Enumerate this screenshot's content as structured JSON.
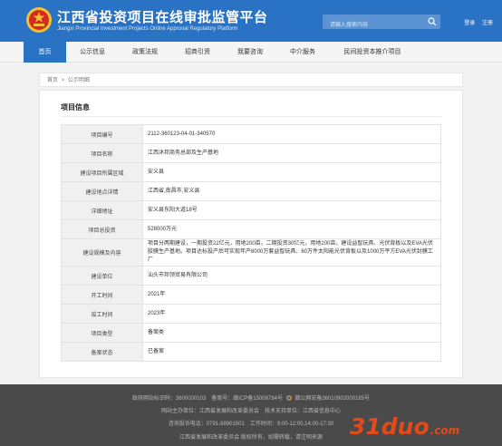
{
  "header": {
    "title": "江西省投资项目在线审批监管平台",
    "subtitle": "Jiangxi Provincial Investment Projects Online Approval Regulatory Platform",
    "search_placeholder": "请输入搜索内容",
    "login_label": "登录",
    "register_label": "注册",
    "colors": {
      "primary": "#2a72c4",
      "emblem_red": "#d22b1f",
      "emblem_gold": "#f3c234"
    },
    "icons": {
      "emblem": "national-emblem-icon",
      "search": "search-icon"
    }
  },
  "nav": {
    "items": [
      {
        "label": "首页",
        "active": true
      },
      {
        "label": "公示信息",
        "active": false
      },
      {
        "label": "政策法规",
        "active": false
      },
      {
        "label": "招商引资",
        "active": false
      },
      {
        "label": "我要咨询",
        "active": false
      },
      {
        "label": "中介服务",
        "active": false
      },
      {
        "label": "民间投资本推介项目",
        "active": false
      }
    ]
  },
  "breadcrumb": {
    "home": "首页",
    "separator": ">",
    "current": "公示明细"
  },
  "panel": {
    "title": "项目信息",
    "rows": [
      {
        "key": "项目编号",
        "value": "2112-360123-04-01-340570"
      },
      {
        "key": "项目名称",
        "value": "江西沐邦商务总部及生产基地"
      },
      {
        "key": "建设项目所属区域",
        "value": "安义县"
      },
      {
        "key": "建设地点详情",
        "value": "江西省,南昌市,安义县"
      },
      {
        "key": "详细地址",
        "value": "安义县东阳大道18号"
      },
      {
        "key": "项目总投资",
        "value": "528000万元"
      },
      {
        "key": "建设规模及内容",
        "value": "项目分两期建设，一期投资22亿元，用地200亩，二期投资30亿元，用地200亩，建设益智玩具、光伏背板以及EVA光伏胶膜生产基地。项目达标投产后可实现年产8000万套益智玩具、60万件太阳能光伏背板以及1000万平方EVA光伏封膜工厂"
      },
      {
        "key": "建设单位",
        "value": "汕头市邦领贸易有限公司"
      },
      {
        "key": "开工时间",
        "value": "2021年"
      },
      {
        "key": "竣工时间",
        "value": "2023年"
      },
      {
        "key": "项目类型",
        "value": "备案类"
      },
      {
        "key": "备案状态",
        "value": "已备案"
      }
    ]
  },
  "footer": {
    "line1_a": "政府网站标识码：3600000103　备案号：赣ICP备15008784号",
    "line1_b": "赣公网安备36010902000185号",
    "line2": "网站主办单位：江西省发展和改革委员会　技术支持单位：江西省信息中心",
    "line3": "咨询投诉电话：0791-88901501　工作时间：9:00-12:00,14:00-17:30",
    "line4": "江西省发展和改革委员会 版权所有，如需转载，请注明来源",
    "icons": {
      "police": "police-badge-icon"
    }
  },
  "watermark": {
    "text": "31duo",
    "suffix": ".com",
    "color": "#e34a1a"
  }
}
